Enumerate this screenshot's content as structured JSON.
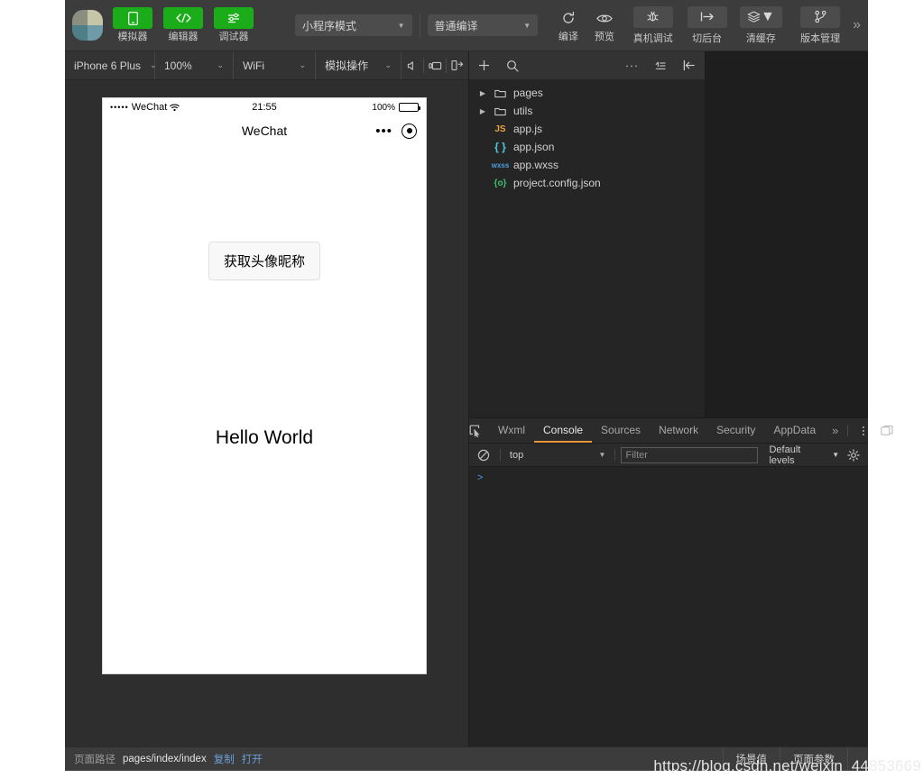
{
  "app": {
    "logo_name": "wechat-devtools-logo"
  },
  "toolbar": {
    "modes": [
      {
        "label": "模拟器",
        "icon": "phone-icon",
        "style": "green"
      },
      {
        "label": "编辑器",
        "icon": "code-icon",
        "style": "green"
      },
      {
        "label": "调试器",
        "icon": "debug-panel-icon",
        "style": "green"
      }
    ],
    "project_mode": "小程序模式",
    "compile_mode": "普通编译",
    "actions": [
      {
        "label": "编译",
        "icon": "refresh-icon",
        "style": "plain"
      },
      {
        "label": "预览",
        "icon": "eye-icon",
        "style": "plain"
      },
      {
        "label": "真机调试",
        "icon": "bug-icon",
        "style": "box"
      },
      {
        "label": "切后台",
        "icon": "background-icon",
        "style": "box"
      },
      {
        "label": "清缓存",
        "icon": "layers-icon",
        "style": "box-caret"
      },
      {
        "label": "版本管理",
        "icon": "git-branch-icon",
        "style": "box"
      }
    ],
    "overflow": "»"
  },
  "simulator": {
    "device": "iPhone 6 Plus",
    "zoom": "100%",
    "network": "WiFi",
    "mock": "模拟操作",
    "icons": [
      "volume-icon",
      "rotate-screen-icon",
      "detach-window-icon"
    ],
    "phone": {
      "status": {
        "signal_dots": "•••••",
        "carrier": "WeChat",
        "wifi_icon": "wifi-icon",
        "time": "21:55",
        "battery_text": "100%"
      },
      "nav": {
        "title": "WeChat",
        "ellipsis": "•••",
        "target_icon": "target-icon"
      },
      "button_label": "获取头像昵称",
      "hello_text": "Hello World"
    }
  },
  "explorer": {
    "toolbar": {
      "add_icon": "plus-icon",
      "search_icon": "search-icon",
      "more_icon": "ellipsis-icon",
      "collapse_icon": "collapse-all-icon",
      "hide_icon": "hide-sidebar-icon"
    },
    "files": [
      {
        "name": "pages",
        "type": "folder",
        "icon": "folder-icon",
        "expandable": true
      },
      {
        "name": "utils",
        "type": "folder",
        "icon": "folder-icon",
        "expandable": true
      },
      {
        "name": "app.js",
        "type": "js",
        "icon": "js-file-icon",
        "badge": "JS"
      },
      {
        "name": "app.json",
        "type": "json",
        "icon": "json-file-icon",
        "badge": "{ }"
      },
      {
        "name": "app.wxss",
        "type": "wxss",
        "icon": "wxss-file-icon",
        "badge": "wxss"
      },
      {
        "name": "project.config.json",
        "type": "config",
        "icon": "config-file-icon",
        "badge": "{o}"
      }
    ]
  },
  "devtools": {
    "inspect_icon": "inspect-element-icon",
    "tabs": [
      {
        "label": "Wxml",
        "active": false
      },
      {
        "label": "Console",
        "active": true
      },
      {
        "label": "Sources",
        "active": false
      },
      {
        "label": "Network",
        "active": false
      },
      {
        "label": "Security",
        "active": false
      },
      {
        "label": "AppData",
        "active": false
      }
    ],
    "more": "»",
    "kebab_icon": "kebab-menu-icon",
    "dock_icon": "dock-panel-icon",
    "console": {
      "clear_icon": "clear-console-icon",
      "context": "top",
      "filter_placeholder": "Filter",
      "filter_value": "",
      "levels": "Default levels",
      "settings_icon": "settings-gear-icon",
      "prompt": ">"
    }
  },
  "statusbar": {
    "path_key": "页面路径",
    "path_value": "pages/index/index",
    "copy_label": "复制",
    "open_label": "打开",
    "scene_label": "场景值",
    "params_label": "页面参数"
  },
  "watermark": {
    "text_strong": "https://blog.csdn.net/weixin_44",
    "text_faded": "853669"
  },
  "colors": {
    "accent_green": "#1aad19",
    "tab_active": "#e8953d",
    "link_blue": "#6a9fd8",
    "toolbar_bg": "#3c3c3c",
    "panel_bg": "#2e2e2e"
  }
}
